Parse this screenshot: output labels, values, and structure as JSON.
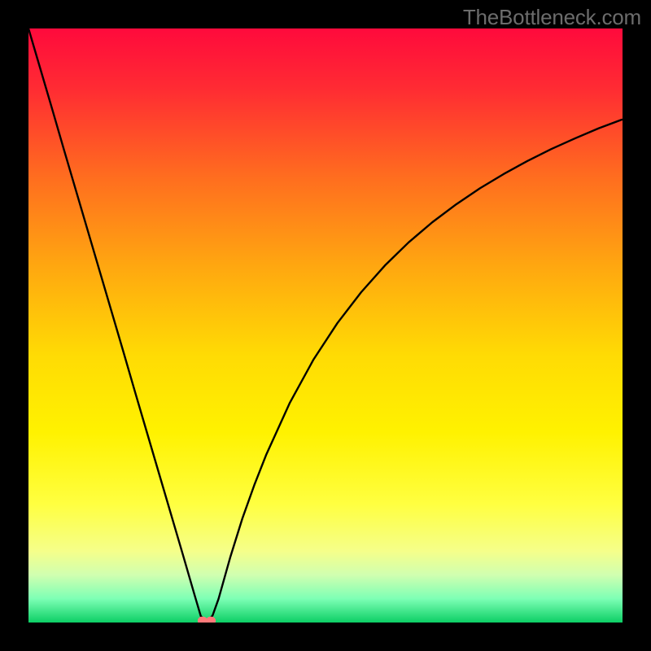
{
  "watermark": "TheBottleneck.com",
  "chart_data": {
    "type": "line",
    "title": "",
    "xlabel": "",
    "ylabel": "",
    "xlim": [
      0,
      100
    ],
    "ylim": [
      0,
      100
    ],
    "grid": false,
    "legend": false,
    "background": {
      "type": "vertical-gradient",
      "description": "red (top) through orange, yellow to green (bottom)",
      "stops": [
        {
          "pos": 0,
          "color": "#ff0a3c"
        },
        {
          "pos": 10,
          "color": "#ff2b33"
        },
        {
          "pos": 25,
          "color": "#ff6d1f"
        },
        {
          "pos": 40,
          "color": "#ffa710"
        },
        {
          "pos": 55,
          "color": "#ffdb04"
        },
        {
          "pos": 68,
          "color": "#fff200"
        },
        {
          "pos": 80,
          "color": "#ffff40"
        },
        {
          "pos": 88,
          "color": "#f5ff8a"
        },
        {
          "pos": 92,
          "color": "#d0ffb0"
        },
        {
          "pos": 96,
          "color": "#7dffb5"
        },
        {
          "pos": 100,
          "color": "#0ccf65"
        }
      ]
    },
    "series": [
      {
        "name": "bottleneck-curve",
        "color": "#000000",
        "x": [
          0,
          2,
          4,
          6,
          8,
          10,
          12,
          14,
          16,
          18,
          20,
          22,
          24,
          26,
          28,
          29,
          30,
          31,
          32,
          34,
          36,
          38,
          40,
          44,
          48,
          52,
          56,
          60,
          64,
          68,
          72,
          76,
          80,
          84,
          88,
          92,
          96,
          100
        ],
        "y": [
          100,
          93.2,
          86.4,
          79.5,
          72.7,
          65.9,
          59.1,
          52.3,
          45.5,
          38.6,
          31.8,
          25.0,
          18.2,
          11.4,
          4.5,
          1.1,
          0.0,
          1.2,
          4.0,
          11.1,
          17.5,
          23.1,
          28.2,
          37.0,
          44.3,
          50.4,
          55.6,
          60.1,
          64.0,
          67.4,
          70.4,
          73.1,
          75.5,
          77.7,
          79.7,
          81.5,
          83.2,
          84.7
        ]
      }
    ],
    "markers": [
      {
        "x": 29.3,
        "y": 0.3,
        "color": "#ff7a7a",
        "shape": "rounded"
      },
      {
        "x": 30.7,
        "y": 0.3,
        "color": "#ff7a7a",
        "shape": "rounded"
      }
    ]
  }
}
